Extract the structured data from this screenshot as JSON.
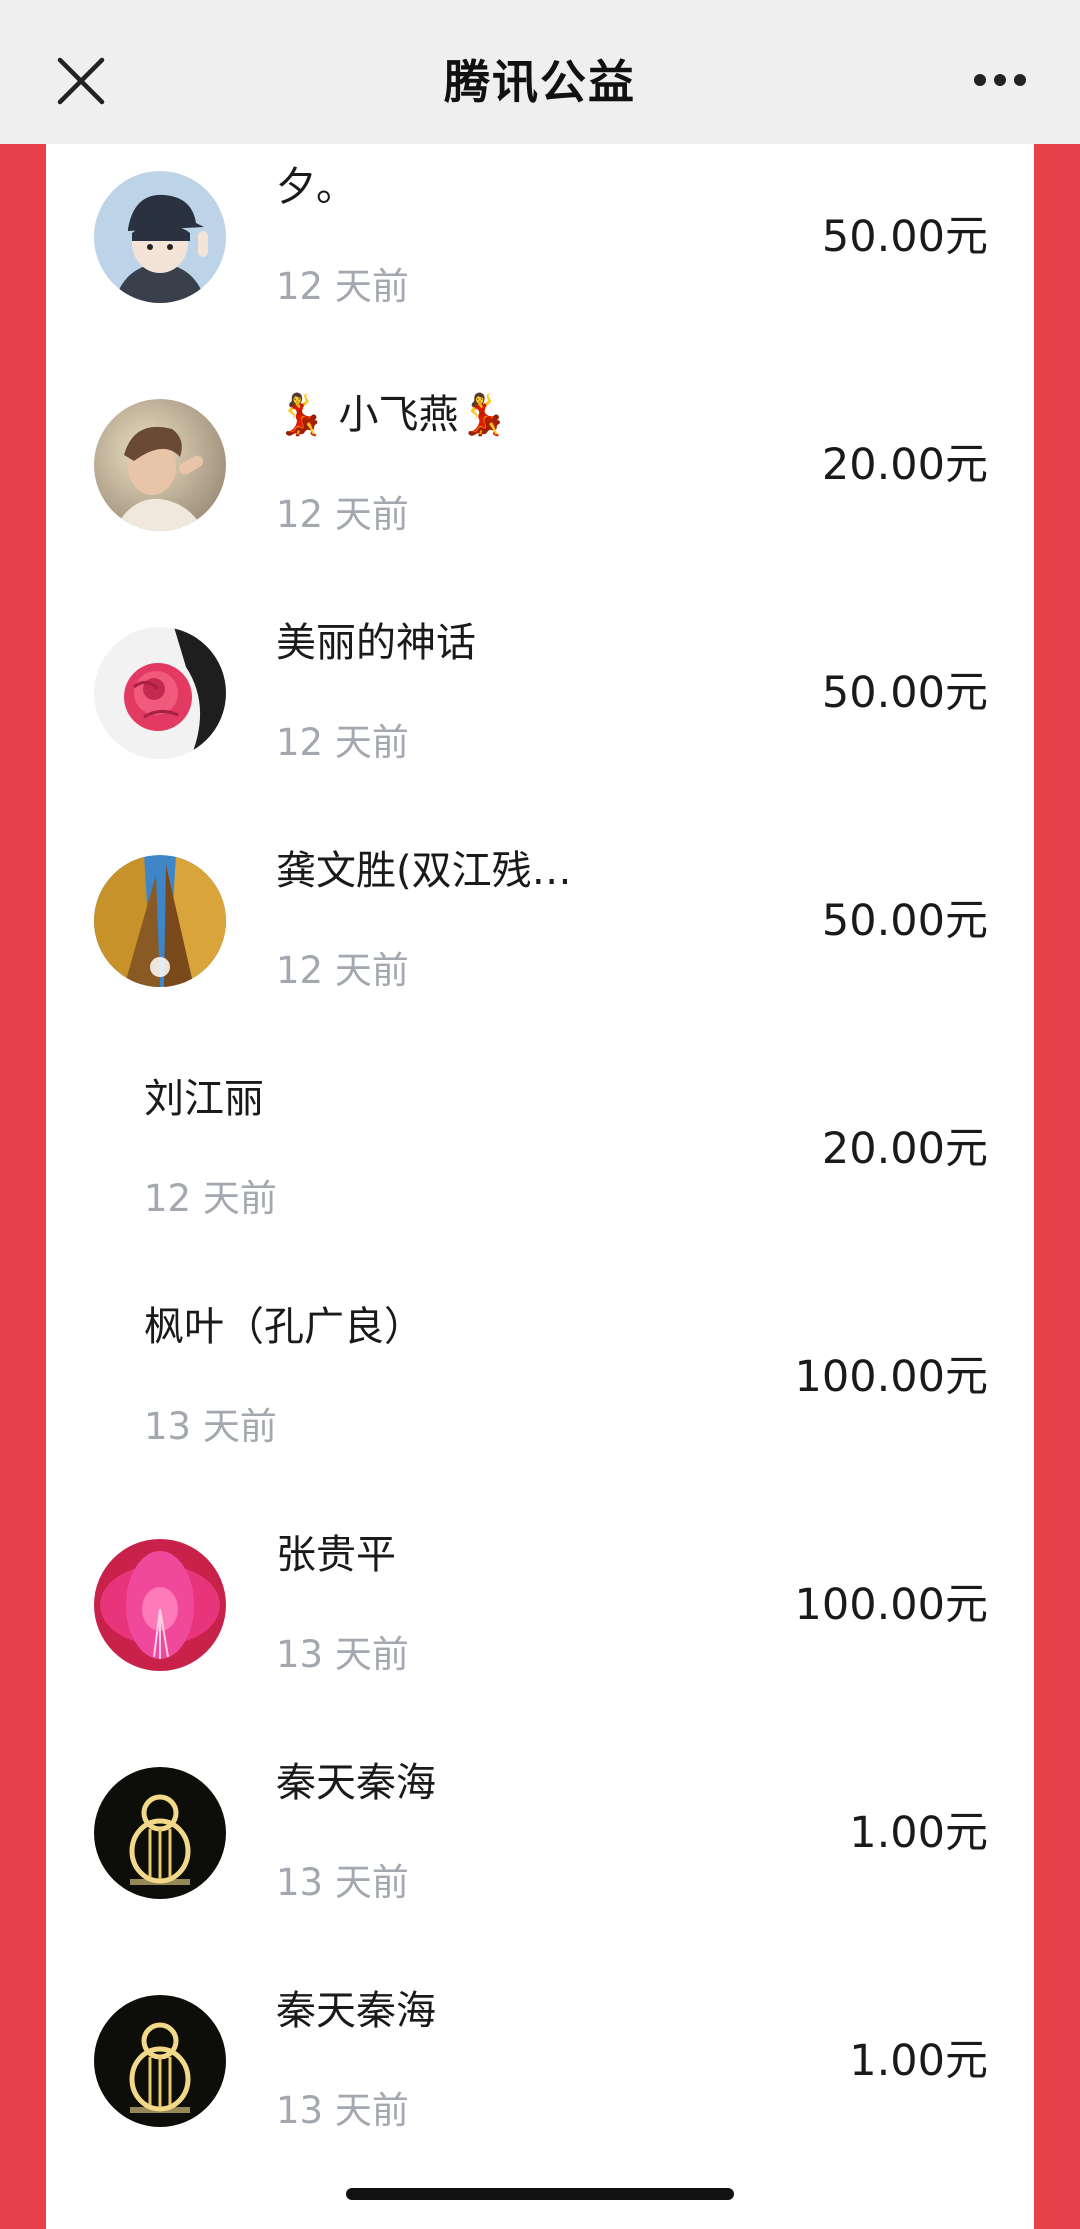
{
  "header": {
    "title": "腾讯公益",
    "close_icon": "close-icon",
    "more_icon": "more-icon"
  },
  "colors": {
    "side_background": "#e8404a",
    "topbar_background": "#efefef",
    "time_text": "#a3a8b0"
  },
  "donations": [
    {
      "name": "夕。",
      "time": "12 天前",
      "amount": "50.00元",
      "avatar": "avatar-cartoon-boy"
    },
    {
      "name": "💃 小飞燕💃",
      "time": "12 天前",
      "amount": "20.00元",
      "avatar": "avatar-woman-photo"
    },
    {
      "name": "美丽的神话",
      "time": "12 天前",
      "amount": "50.00元",
      "avatar": "avatar-red-rose"
    },
    {
      "name": "龚文胜(双江残…",
      "time": "12 天前",
      "amount": "50.00元",
      "avatar": "avatar-autumn-trees"
    },
    {
      "name": "刘江丽",
      "time": "12 天前",
      "amount": "20.00元",
      "avatar": null
    },
    {
      "name": "枫叶（孔广良）",
      "time": "13 天前",
      "amount": "100.00元",
      "avatar": null
    },
    {
      "name": "张贵平",
      "time": "13 天前",
      "amount": "100.00元",
      "avatar": "avatar-pink-flower"
    },
    {
      "name": "秦天秦海",
      "time": "13 天前",
      "amount": "1.00元",
      "avatar": "avatar-light-gourd"
    },
    {
      "name": "秦天秦海",
      "time": "13 天前",
      "amount": "1.00元",
      "avatar": "avatar-light-gourd"
    }
  ]
}
